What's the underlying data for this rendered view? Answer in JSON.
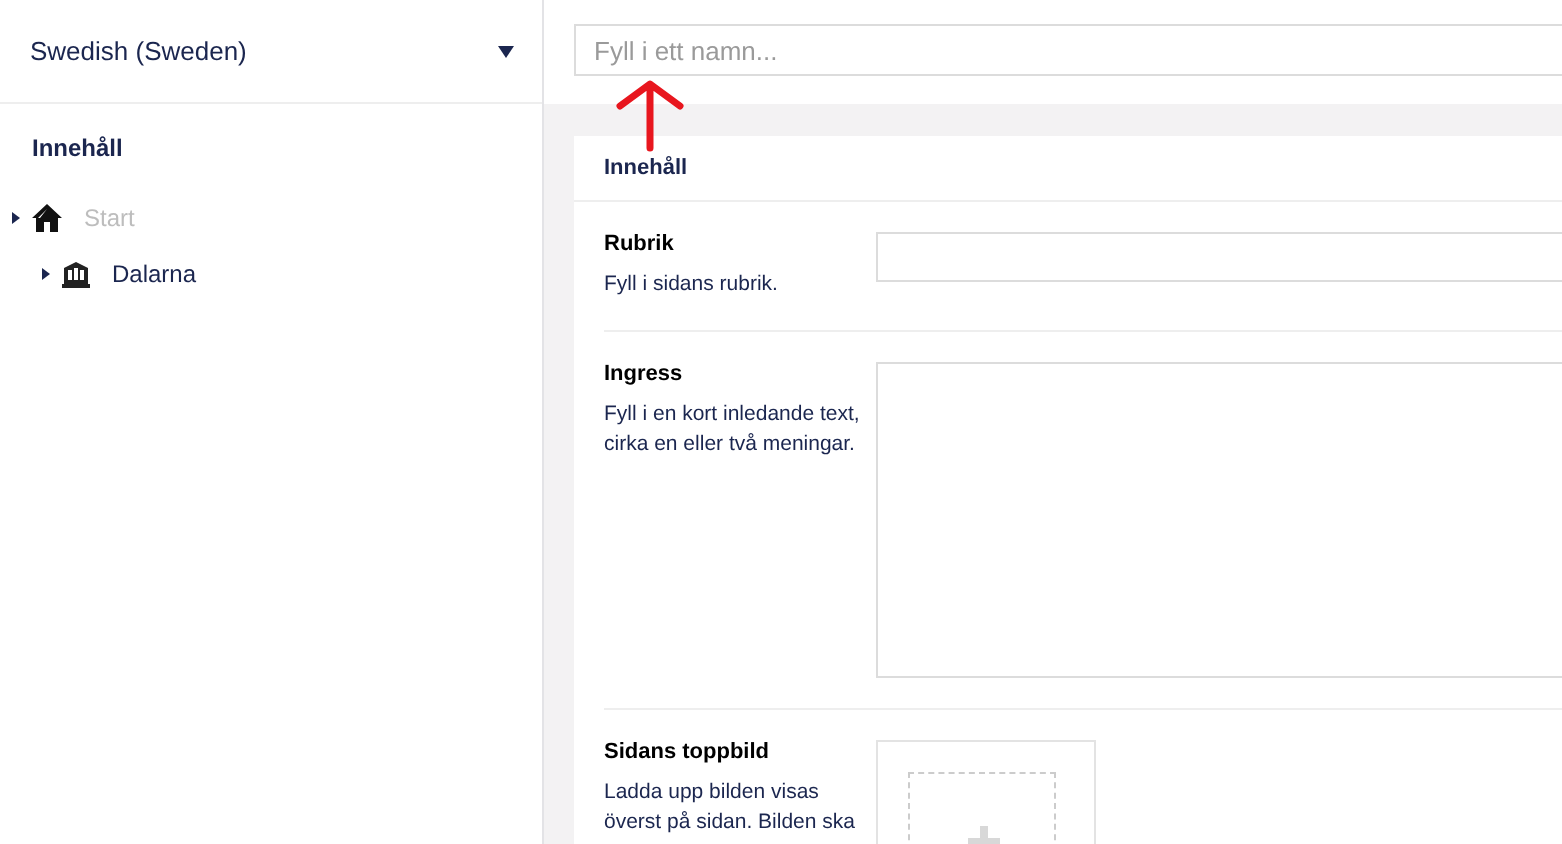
{
  "sidebar": {
    "language": "Swedish (Sweden)",
    "section_title": "Innehåll",
    "tree": [
      {
        "label": "Start",
        "kind": "home",
        "unpublished": true,
        "children": [
          {
            "label": "Dalarna",
            "kind": "building",
            "unpublished": false
          }
        ]
      }
    ]
  },
  "editor": {
    "name_field": {
      "placeholder": "Fyll i ett namn..."
    },
    "tab": "Innehåll",
    "properties": [
      {
        "kind": "text",
        "label": "Rubrik",
        "description": "Fyll i sidans rubrik."
      },
      {
        "kind": "textarea",
        "label": "Ingress",
        "description": "Fyll i en kort inledande text, cirka en eller två meningar."
      },
      {
        "kind": "image",
        "label": "Sidans toppbild",
        "description": "Ladda upp bilden visas överst på sidan. Bilden ska"
      }
    ]
  }
}
